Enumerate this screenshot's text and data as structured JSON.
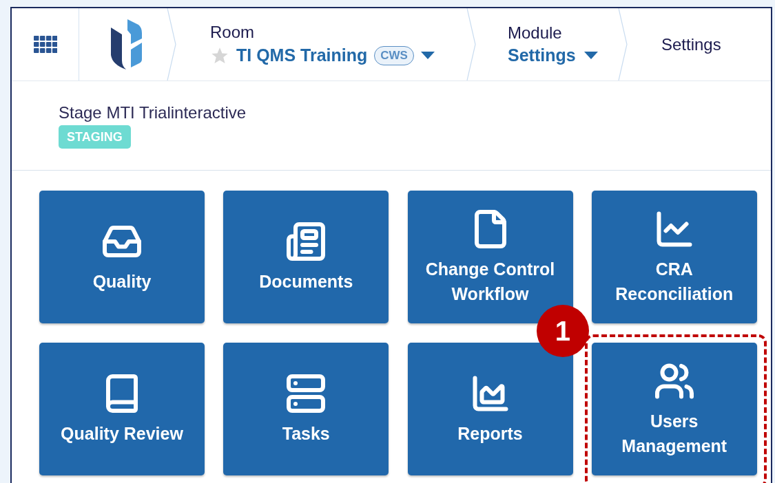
{
  "breadcrumb": {
    "room": {
      "label": "Room",
      "name": "TI QMS Training",
      "favorite": false,
      "badge": "CWS"
    },
    "module": {
      "label": "Module",
      "name": "Settings"
    },
    "current": "Settings"
  },
  "site": {
    "name": "Stage MTI Trialinteractive",
    "badge": "STAGING"
  },
  "tiles": [
    {
      "label": "Quality",
      "highlighted": false
    },
    {
      "label": "Documents",
      "highlighted": false
    },
    {
      "label": "Change Control Workflow",
      "highlighted": false
    },
    {
      "label": "CRA Reconciliation",
      "highlighted": false
    },
    {
      "label": "Quality Review",
      "highlighted": false
    },
    {
      "label": "Tasks",
      "highlighted": false
    },
    {
      "label": "Reports",
      "highlighted": false
    },
    {
      "label": "Users Management",
      "highlighted": true,
      "callout": "1"
    }
  ]
}
